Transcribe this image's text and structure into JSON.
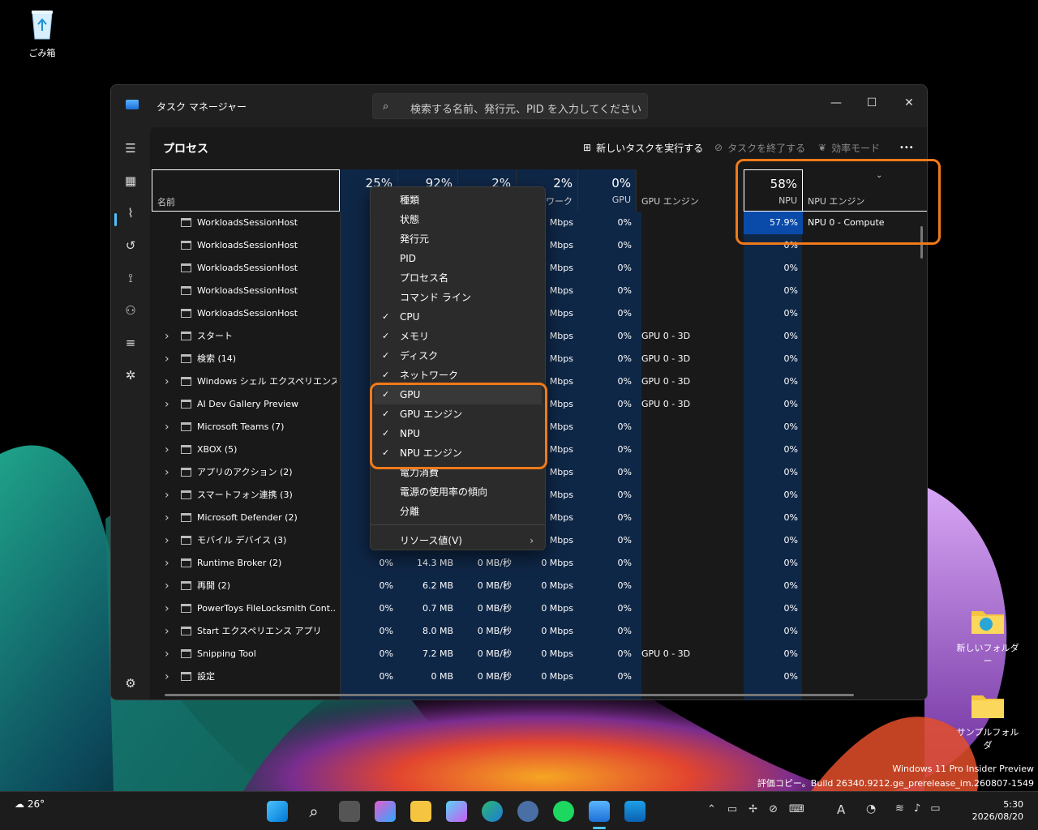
{
  "desktop": {
    "recycle_bin": "ごみ箱",
    "folder1": "新しいフォルダー",
    "folder2": "サンプルフォルダ",
    "watermark_line1": "Windows 11 Pro Insider Preview",
    "watermark_line2": "評価コピー。Build 26340.9212.ge_prerelease_im.260807-1549"
  },
  "window": {
    "title": "タスク マネージャー",
    "search_placeholder": "検索する名前、発行元、PID を入力してください",
    "min": "—",
    "max": "☐",
    "close": "✕"
  },
  "toolbar": {
    "page_title": "プロセス",
    "run_task": "新しいタスクを実行する",
    "end_task": "タスクを終了する",
    "efficiency": "効率モード",
    "more": "•••"
  },
  "columns": {
    "name": "名前",
    "cpu_pct": "25%",
    "mem_pct": "92%",
    "disk_pct": "2%",
    "net_pct": "2%",
    "net_label": "ネットワーク",
    "gpu_pct": "0%",
    "gpu_label": "GPU",
    "gpu_engine_label": "GPU エンジン",
    "npu_pct": "58%",
    "npu_label": "NPU",
    "npu_engine_label": "NPU エンジン"
  },
  "rows": [
    {
      "name": "WorkloadsSessionHost",
      "expand": false,
      "indent": true,
      "cpu": "",
      "mem": "",
      "disk": "",
      "net": "Mbps",
      "gpu": "0%",
      "gpu_engine": "",
      "npu": "57.9%",
      "npu_engine": "NPU 0 - Compute"
    },
    {
      "name": "WorkloadsSessionHost",
      "expand": false,
      "indent": true,
      "cpu": "",
      "mem": "",
      "disk": "",
      "net": "Mbps",
      "gpu": "0%",
      "gpu_engine": "",
      "npu": "0%",
      "npu_engine": ""
    },
    {
      "name": "WorkloadsSessionHost",
      "expand": false,
      "indent": true,
      "cpu": "",
      "mem": "",
      "disk": "",
      "net": "Mbps",
      "gpu": "0%",
      "gpu_engine": "",
      "npu": "0%",
      "npu_engine": ""
    },
    {
      "name": "WorkloadsSessionHost",
      "expand": false,
      "indent": true,
      "cpu": "",
      "mem": "",
      "disk": "",
      "net": "Mbps",
      "gpu": "0%",
      "gpu_engine": "",
      "npu": "0%",
      "npu_engine": ""
    },
    {
      "name": "WorkloadsSessionHost",
      "expand": false,
      "indent": true,
      "cpu": "",
      "mem": "",
      "disk": "",
      "net": "Mbps",
      "gpu": "0%",
      "gpu_engine": "",
      "npu": "0%",
      "npu_engine": ""
    },
    {
      "name": "スタート",
      "expand": true,
      "cpu": "",
      "mem": "",
      "disk": "",
      "net": "Mbps",
      "gpu": "0%",
      "gpu_engine": "GPU 0 - 3D",
      "npu": "0%",
      "npu_engine": ""
    },
    {
      "name": "検索 (14)",
      "expand": true,
      "cpu": "",
      "mem": "",
      "disk": "",
      "net": "Mbps",
      "gpu": "0%",
      "gpu_engine": "GPU 0 - 3D",
      "npu": "0%",
      "npu_engine": ""
    },
    {
      "name": "Windows シェル エクスペリエンス ...",
      "expand": true,
      "cpu": "",
      "mem": "",
      "disk": "",
      "net": "Mbps",
      "gpu": "0%",
      "gpu_engine": "GPU 0 - 3D",
      "npu": "0%",
      "npu_engine": ""
    },
    {
      "name": "AI Dev Gallery Preview",
      "expand": true,
      "cpu": "",
      "mem": "",
      "disk": "",
      "net": "Mbps",
      "gpu": "0%",
      "gpu_engine": "GPU 0 - 3D",
      "npu": "0%",
      "npu_engine": ""
    },
    {
      "name": "Microsoft Teams (7)",
      "expand": true,
      "cpu": "",
      "mem": "",
      "disk": "",
      "net": "Mbps",
      "gpu": "0%",
      "gpu_engine": "",
      "npu": "0%",
      "npu_engine": ""
    },
    {
      "name": "XBOX (5)",
      "expand": true,
      "cpu": "",
      "mem": "",
      "disk": "",
      "net": "Mbps",
      "gpu": "0%",
      "gpu_engine": "",
      "npu": "0%",
      "npu_engine": ""
    },
    {
      "name": "アプリのアクション (2)",
      "expand": true,
      "cpu": "",
      "mem": "",
      "disk": "",
      "net": "Mbps",
      "gpu": "0%",
      "gpu_engine": "",
      "npu": "0%",
      "npu_engine": ""
    },
    {
      "name": "スマートフォン連携 (3)",
      "expand": true,
      "cpu": "",
      "mem": "",
      "disk": "",
      "net": "Mbps",
      "gpu": "0%",
      "gpu_engine": "",
      "npu": "0%",
      "npu_engine": ""
    },
    {
      "name": "Microsoft Defender (2)",
      "expand": true,
      "cpu": "",
      "mem": "",
      "disk": "",
      "net": "Mbps",
      "gpu": "0%",
      "gpu_engine": "",
      "npu": "0%",
      "npu_engine": ""
    },
    {
      "name": "モバイル デバイス (3)",
      "expand": true,
      "cpu": "",
      "mem": "",
      "disk": "",
      "net": "Mbps",
      "gpu": "0%",
      "gpu_engine": "",
      "npu": "0%",
      "npu_engine": ""
    },
    {
      "name": "Runtime Broker (2)",
      "expand": true,
      "cpu": "0%",
      "mem": "14.3 MB",
      "disk": "0 MB/秒",
      "net": "0 Mbps",
      "gpu": "0%",
      "gpu_engine": "",
      "npu": "0%",
      "npu_engine": ""
    },
    {
      "name": "再開 (2)",
      "expand": true,
      "cpu": "0%",
      "mem": "6.2 MB",
      "disk": "0 MB/秒",
      "net": "0 Mbps",
      "gpu": "0%",
      "gpu_engine": "",
      "npu": "0%",
      "npu_engine": ""
    },
    {
      "name": "PowerToys FileLocksmith Cont...",
      "expand": true,
      "cpu": "0%",
      "mem": "0.7 MB",
      "disk": "0 MB/秒",
      "net": "0 Mbps",
      "gpu": "0%",
      "gpu_engine": "",
      "npu": "0%",
      "npu_engine": ""
    },
    {
      "name": "Start エクスペリエンス アプリ",
      "expand": true,
      "cpu": "0%",
      "mem": "8.0 MB",
      "disk": "0 MB/秒",
      "net": "0 Mbps",
      "gpu": "0%",
      "gpu_engine": "",
      "npu": "0%",
      "npu_engine": ""
    },
    {
      "name": "Snipping Tool",
      "expand": true,
      "cpu": "0%",
      "mem": "7.2 MB",
      "disk": "0 MB/秒",
      "net": "0 Mbps",
      "gpu": "0%",
      "gpu_engine": "GPU 0 - 3D",
      "npu": "0%",
      "npu_engine": ""
    },
    {
      "name": "設定",
      "expand": true,
      "cpu": "0%",
      "mem": "0 MB",
      "disk": "0 MB/秒",
      "net": "0 Mbps",
      "gpu": "0%",
      "gpu_engine": "",
      "npu": "0%",
      "npu_engine": ""
    }
  ],
  "context_menu": [
    {
      "label": "種類",
      "checked": false
    },
    {
      "label": "状態",
      "checked": false
    },
    {
      "label": "発行元",
      "checked": false
    },
    {
      "label": "PID",
      "checked": false
    },
    {
      "label": "プロセス名",
      "checked": false
    },
    {
      "label": "コマンド ライン",
      "checked": false
    },
    {
      "label": "CPU",
      "checked": true
    },
    {
      "label": "メモリ",
      "checked": true
    },
    {
      "label": "ディスク",
      "checked": true
    },
    {
      "label": "ネットワーク",
      "checked": true
    },
    {
      "label": "GPU",
      "checked": true
    },
    {
      "label": "GPU エンジン",
      "checked": true
    },
    {
      "label": "NPU",
      "checked": true
    },
    {
      "label": "NPU エンジン",
      "checked": true
    },
    {
      "label": "電力消費",
      "checked": false
    },
    {
      "label": "電源の使用率の傾向",
      "checked": false
    },
    {
      "label": "分離",
      "checked": false
    },
    {
      "label": "リソース値(V)",
      "checked": false,
      "submenu": true
    }
  ],
  "taskbar": {
    "weather": "26°",
    "time": "5:30",
    "date": "2026/08/20",
    "ime": "A",
    "check": "✓",
    "arrow": "›"
  }
}
